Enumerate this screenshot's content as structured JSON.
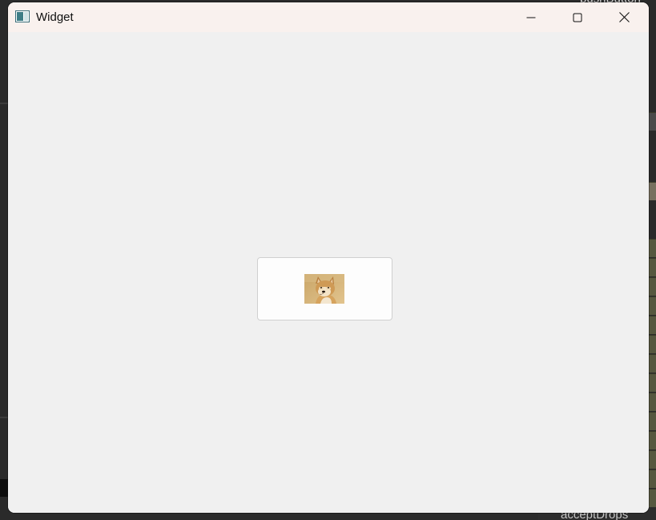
{
  "window": {
    "title": "Widget",
    "icon": "qt-widget-app-icon",
    "controls": {
      "minimize_icon": "minimize-icon",
      "maximize_icon": "maximize-icon",
      "close_icon": "close-icon"
    }
  },
  "content": {
    "push_button": {
      "icon": "doge-image-icon"
    }
  },
  "background": {
    "top_right_text": "pushButton",
    "bottom_right_text": "acceptDrops"
  },
  "colors": {
    "titlebar": "#f9f1ee",
    "client": "#f0f0f0",
    "button_bg": "#fdfdfd",
    "button_border": "#d0d0d0"
  }
}
